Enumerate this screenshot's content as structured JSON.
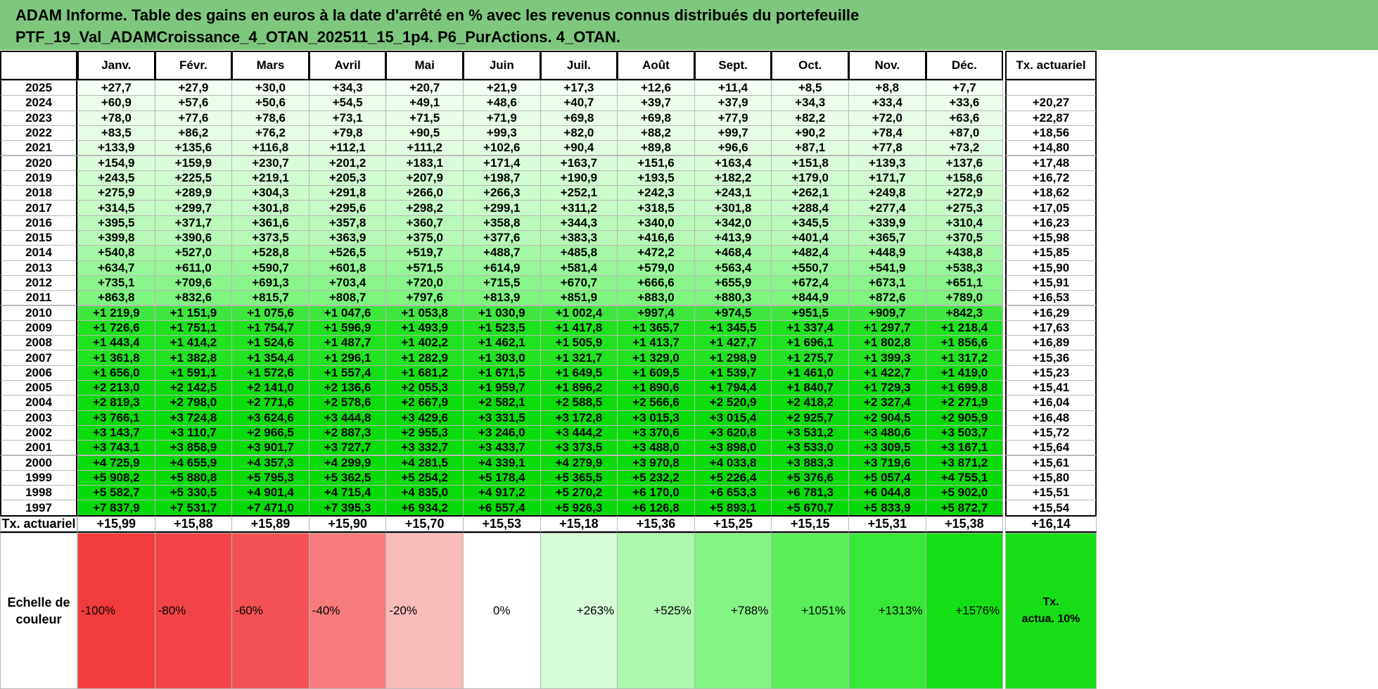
{
  "header": {
    "line1": "ADAM Informe. Table des gains en euros à la date d'arrêté en % avec les revenus connus distribués du portefeuille",
    "line2": "PTF_19_Val_ADAMCroissance_4_OTAN_202511_15_1p4. P6_PurActions. 4_OTAN."
  },
  "months": [
    "Janv.",
    "Févr.",
    "Mars",
    "Avril",
    "Mai",
    "Juin",
    "Juil.",
    "Août",
    "Sept.",
    "Oct.",
    "Nov.",
    "Déc."
  ],
  "rate_header": "Tx. actuariel",
  "rows": [
    {
      "year": "2025",
      "values": [
        "+27,7",
        "+27,9",
        "+30,0",
        "+34,3",
        "+20,7",
        "+21,9",
        "+17,3",
        "+12,6",
        "+11,4",
        "+8,5",
        "+8,8",
        "+7,7"
      ],
      "rate": ""
    },
    {
      "year": "2024",
      "values": [
        "+60,9",
        "+57,6",
        "+50,6",
        "+54,5",
        "+49,1",
        "+48,6",
        "+40,7",
        "+39,7",
        "+37,9",
        "+34,3",
        "+33,4",
        "+33,6"
      ],
      "rate": "+20,27"
    },
    {
      "year": "2023",
      "values": [
        "+78,0",
        "+77,6",
        "+78,6",
        "+73,1",
        "+71,5",
        "+71,9",
        "+69,8",
        "+69,8",
        "+77,9",
        "+82,2",
        "+72,0",
        "+63,6"
      ],
      "rate": "+22,87"
    },
    {
      "year": "2022",
      "values": [
        "+83,5",
        "+86,2",
        "+76,2",
        "+79,8",
        "+90,5",
        "+99,3",
        "+82,0",
        "+88,2",
        "+99,7",
        "+90,2",
        "+78,4",
        "+87,0"
      ],
      "rate": "+18,56"
    },
    {
      "year": "2021",
      "values": [
        "+133,9",
        "+135,6",
        "+116,8",
        "+112,1",
        "+111,2",
        "+102,6",
        "+90,4",
        "+89,8",
        "+96,6",
        "+87,1",
        "+77,8",
        "+73,2"
      ],
      "rate": "+14,80"
    },
    {
      "year": "2020",
      "values": [
        "+154,9",
        "+159,9",
        "+230,7",
        "+201,2",
        "+183,1",
        "+171,4",
        "+163,7",
        "+151,6",
        "+163,4",
        "+151,8",
        "+139,3",
        "+137,6"
      ],
      "rate": "+17,48"
    },
    {
      "year": "2019",
      "values": [
        "+243,5",
        "+225,5",
        "+219,1",
        "+205,3",
        "+207,9",
        "+198,7",
        "+190,9",
        "+193,5",
        "+182,2",
        "+179,0",
        "+171,7",
        "+158,6"
      ],
      "rate": "+16,72"
    },
    {
      "year": "2018",
      "values": [
        "+275,9",
        "+289,9",
        "+304,3",
        "+291,8",
        "+266,0",
        "+266,3",
        "+252,1",
        "+242,3",
        "+243,1",
        "+262,1",
        "+249,8",
        "+272,9"
      ],
      "rate": "+18,62"
    },
    {
      "year": "2017",
      "values": [
        "+314,5",
        "+299,7",
        "+301,8",
        "+295,6",
        "+298,2",
        "+299,1",
        "+311,2",
        "+318,5",
        "+301,8",
        "+288,4",
        "+277,4",
        "+275,3"
      ],
      "rate": "+17,05"
    },
    {
      "year": "2016",
      "values": [
        "+395,5",
        "+371,7",
        "+361,6",
        "+357,8",
        "+360,7",
        "+358,8",
        "+344,3",
        "+340,0",
        "+342,0",
        "+345,5",
        "+339,9",
        "+310,4"
      ],
      "rate": "+16,23"
    },
    {
      "year": "2015",
      "values": [
        "+399,8",
        "+390,6",
        "+373,5",
        "+363,9",
        "+375,0",
        "+377,6",
        "+383,3",
        "+416,6",
        "+413,9",
        "+401,4",
        "+365,7",
        "+370,5"
      ],
      "rate": "+15,98"
    },
    {
      "year": "2014",
      "values": [
        "+540,8",
        "+527,0",
        "+528,8",
        "+526,5",
        "+519,7",
        "+488,7",
        "+485,8",
        "+472,2",
        "+468,4",
        "+482,4",
        "+448,9",
        "+438,8"
      ],
      "rate": "+15,85"
    },
    {
      "year": "2013",
      "values": [
        "+634,7",
        "+611,0",
        "+590,7",
        "+601,8",
        "+571,5",
        "+614,9",
        "+581,4",
        "+579,0",
        "+563,4",
        "+550,7",
        "+541,9",
        "+538,3"
      ],
      "rate": "+15,90"
    },
    {
      "year": "2012",
      "values": [
        "+735,1",
        "+709,6",
        "+691,3",
        "+703,4",
        "+720,0",
        "+715,5",
        "+670,7",
        "+666,6",
        "+655,9",
        "+672,4",
        "+673,1",
        "+651,1"
      ],
      "rate": "+15,91"
    },
    {
      "year": "2011",
      "values": [
        "+863,8",
        "+832,6",
        "+815,7",
        "+808,7",
        "+797,6",
        "+813,9",
        "+851,9",
        "+883,0",
        "+880,3",
        "+844,9",
        "+872,6",
        "+789,0"
      ],
      "rate": "+16,53"
    },
    {
      "year": "2010",
      "values": [
        "+1 219,9",
        "+1 151,9",
        "+1 075,6",
        "+1 047,6",
        "+1 053,8",
        "+1 030,9",
        "+1 002,4",
        "+997,4",
        "+974,5",
        "+951,5",
        "+909,7",
        "+842,3"
      ],
      "rate": "+16,29"
    },
    {
      "year": "2009",
      "values": [
        "+1 726,6",
        "+1 751,1",
        "+1 754,7",
        "+1 596,9",
        "+1 493,9",
        "+1 523,5",
        "+1 417,8",
        "+1 365,7",
        "+1 345,5",
        "+1 337,4",
        "+1 297,7",
        "+1 218,4"
      ],
      "rate": "+17,63"
    },
    {
      "year": "2008",
      "values": [
        "+1 443,4",
        "+1 414,2",
        "+1 524,6",
        "+1 487,7",
        "+1 402,2",
        "+1 462,1",
        "+1 505,9",
        "+1 413,7",
        "+1 427,7",
        "+1 696,1",
        "+1 802,8",
        "+1 856,6"
      ],
      "rate": "+16,89"
    },
    {
      "year": "2007",
      "values": [
        "+1 361,8",
        "+1 382,8",
        "+1 354,4",
        "+1 296,1",
        "+1 282,9",
        "+1 303,0",
        "+1 321,7",
        "+1 329,0",
        "+1 298,9",
        "+1 275,7",
        "+1 399,3",
        "+1 317,2"
      ],
      "rate": "+15,36"
    },
    {
      "year": "2006",
      "values": [
        "+1 656,0",
        "+1 591,1",
        "+1 572,6",
        "+1 557,4",
        "+1 681,2",
        "+1 671,5",
        "+1 649,5",
        "+1 609,5",
        "+1 539,7",
        "+1 461,0",
        "+1 422,7",
        "+1 419,0"
      ],
      "rate": "+15,23"
    },
    {
      "year": "2005",
      "values": [
        "+2 213,0",
        "+2 142,5",
        "+2 141,0",
        "+2 136,6",
        "+2 055,3",
        "+1 959,7",
        "+1 896,2",
        "+1 890,6",
        "+1 794,4",
        "+1 840,7",
        "+1 729,3",
        "+1 699,8"
      ],
      "rate": "+15,41"
    },
    {
      "year": "2004",
      "values": [
        "+2 819,3",
        "+2 798,0",
        "+2 771,6",
        "+2 578,6",
        "+2 667,9",
        "+2 582,1",
        "+2 588,5",
        "+2 566,6",
        "+2 520,9",
        "+2 418,2",
        "+2 327,4",
        "+2 271,9"
      ],
      "rate": "+16,04"
    },
    {
      "year": "2003",
      "values": [
        "+3 766,1",
        "+3 724,8",
        "+3 624,6",
        "+3 444,8",
        "+3 429,6",
        "+3 331,5",
        "+3 172,8",
        "+3 015,3",
        "+3 015,4",
        "+2 925,7",
        "+2 904,5",
        "+2 905,9"
      ],
      "rate": "+16,48"
    },
    {
      "year": "2002",
      "values": [
        "+3 143,7",
        "+3 110,7",
        "+2 966,5",
        "+2 887,3",
        "+2 955,3",
        "+3 246,0",
        "+3 444,2",
        "+3 370,6",
        "+3 620,8",
        "+3 531,2",
        "+3 480,6",
        "+3 503,7"
      ],
      "rate": "+15,72"
    },
    {
      "year": "2001",
      "values": [
        "+3 743,1",
        "+3 858,9",
        "+3 901,7",
        "+3 727,7",
        "+3 332,7",
        "+3 433,7",
        "+3 373,5",
        "+3 488,0",
        "+3 898,0",
        "+3 533,0",
        "+3 309,5",
        "+3 167,1"
      ],
      "rate": "+15,64"
    },
    {
      "year": "2000",
      "values": [
        "+4 725,9",
        "+4 655,9",
        "+4 357,3",
        "+4 299,9",
        "+4 281,5",
        "+4 339,1",
        "+4 279,9",
        "+3 970,8",
        "+4 033,8",
        "+3 883,3",
        "+3 719,6",
        "+3 871,2"
      ],
      "rate": "+15,61"
    },
    {
      "year": "1999",
      "values": [
        "+5 908,2",
        "+5 880,8",
        "+5 795,3",
        "+5 362,5",
        "+5 254,2",
        "+5 178,4",
        "+5 365,5",
        "+5 232,2",
        "+5 226,4",
        "+5 376,6",
        "+5 057,4",
        "+4 755,1"
      ],
      "rate": "+15,80"
    },
    {
      "year": "1998",
      "values": [
        "+5 582,7",
        "+5 330,5",
        "+4 901,4",
        "+4 715,4",
        "+4 835,0",
        "+4 917,2",
        "+5 270,2",
        "+6 170,0",
        "+6 653,3",
        "+6 781,3",
        "+6 044,8",
        "+5 902,0"
      ],
      "rate": "+15,51"
    },
    {
      "year": "1997",
      "values": [
        "+7 837,9",
        "+7 531,7",
        "+7 471,0",
        "+7 395,3",
        "+6 934,2",
        "+6 557,4",
        "+5 926,3",
        "+6 126,8",
        "+5 893,1",
        "+5 670,7",
        "+5 833,9",
        "+5 872,7"
      ],
      "rate": "+15,54"
    }
  ],
  "row_colors": [
    "#f4fff4",
    "#ecfdec",
    "#e9fde9",
    "#e6fde6",
    "#e1fde1",
    "#dbfcdb",
    "#d0fbd0",
    "#cbfbcb",
    "#c6fac6",
    "#b9f9b9",
    "#b7f9b7",
    "#a5f8a5",
    "#98f798",
    "#8af58a",
    "#7ff47f",
    "#3fe63f",
    "#1ee21e",
    "#20e220",
    "#22e222",
    "#16de16",
    "#0fdc0f",
    "#0cdc0c",
    "#0adb0a",
    "#0adb0a",
    "#0adb0a",
    "#0adb0a",
    "#08da08",
    "#08da08",
    "#06da06"
  ],
  "footer": {
    "label": "Tx. actuariel",
    "values": [
      "+15,99",
      "+15,88",
      "+15,89",
      "+15,90",
      "+15,70",
      "+15,53",
      "+15,18",
      "+15,36",
      "+15,25",
      "+15,15",
      "+15,31",
      "+15,38"
    ],
    "total": "+16,14"
  },
  "scale": {
    "label_line1": "Echelle de",
    "label_line2": "couleur",
    "items": [
      {
        "text": "-100%",
        "color": "#f23b3b"
      },
      {
        "text": "-80%",
        "color": "#f34545"
      },
      {
        "text": "-60%",
        "color": "#f45252"
      },
      {
        "text": "-40%",
        "color": "#f67c7c"
      },
      {
        "text": "-20%",
        "color": "#fbbcbc"
      },
      {
        "text": "0%",
        "color": "#ffffff"
      },
      {
        "text": "+263%",
        "color": "#d6fcd6"
      },
      {
        "text": "+525%",
        "color": "#acf8ac"
      },
      {
        "text": "+788%",
        "color": "#84f484"
      },
      {
        "text": "+1051%",
        "color": "#5aee5a"
      },
      {
        "text": "+1313%",
        "color": "#38e838"
      },
      {
        "text": "+1576%",
        "color": "#14de14"
      }
    ],
    "rate_line1": "Tx.",
    "rate_line2": "actua. 10%",
    "rate_color": "#18de18"
  }
}
